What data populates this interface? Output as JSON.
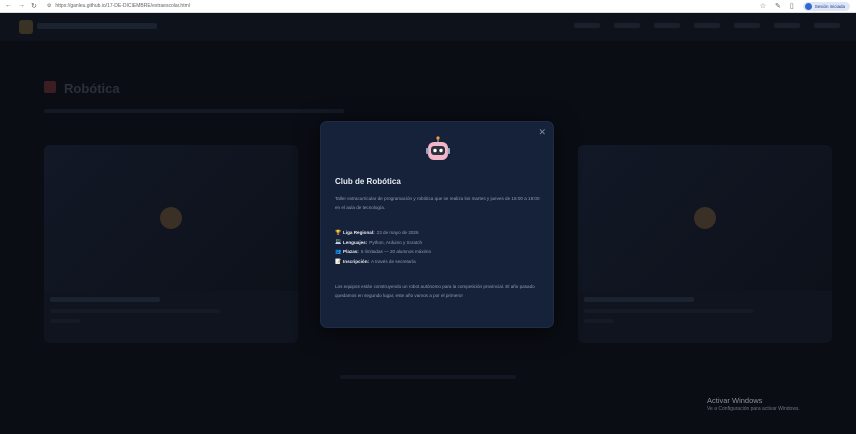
{
  "browser": {
    "url": "https://ganleu.github.io/17-DE-DICIEMBRE/extraescolar.html",
    "profile_label": "Sesión iniciada"
  },
  "page": {
    "section_title": "Robótica"
  },
  "modal": {
    "title": "Club de Robótica",
    "description": "Taller extracurricular de programación y robótica que se realiza los martes y jueves de 16:00 a 18:00 en el aula de tecnología.",
    "facts": [
      {
        "icon": "🏆",
        "label": "Liga Regional:",
        "value": "23 de mayo de 2026"
      },
      {
        "icon": "💻",
        "label": "Lenguajes:",
        "value": "Python, Arduino y Scratch"
      },
      {
        "icon": "👥",
        "label": "Plazas:",
        "value": "5 limitadas — 20 alumnos máximo"
      },
      {
        "icon": "📝",
        "label": "Inscripción:",
        "value": "A través de secretaría"
      }
    ],
    "note": "Los equipos están construyendo un robot autónomo para la competición provincial. El año pasado quedamos en segundo lugar, este año vamos a por el primero!"
  },
  "watermark": {
    "line1": "Activar Windows",
    "line2": "Ve a Configuración para activar Windows."
  }
}
